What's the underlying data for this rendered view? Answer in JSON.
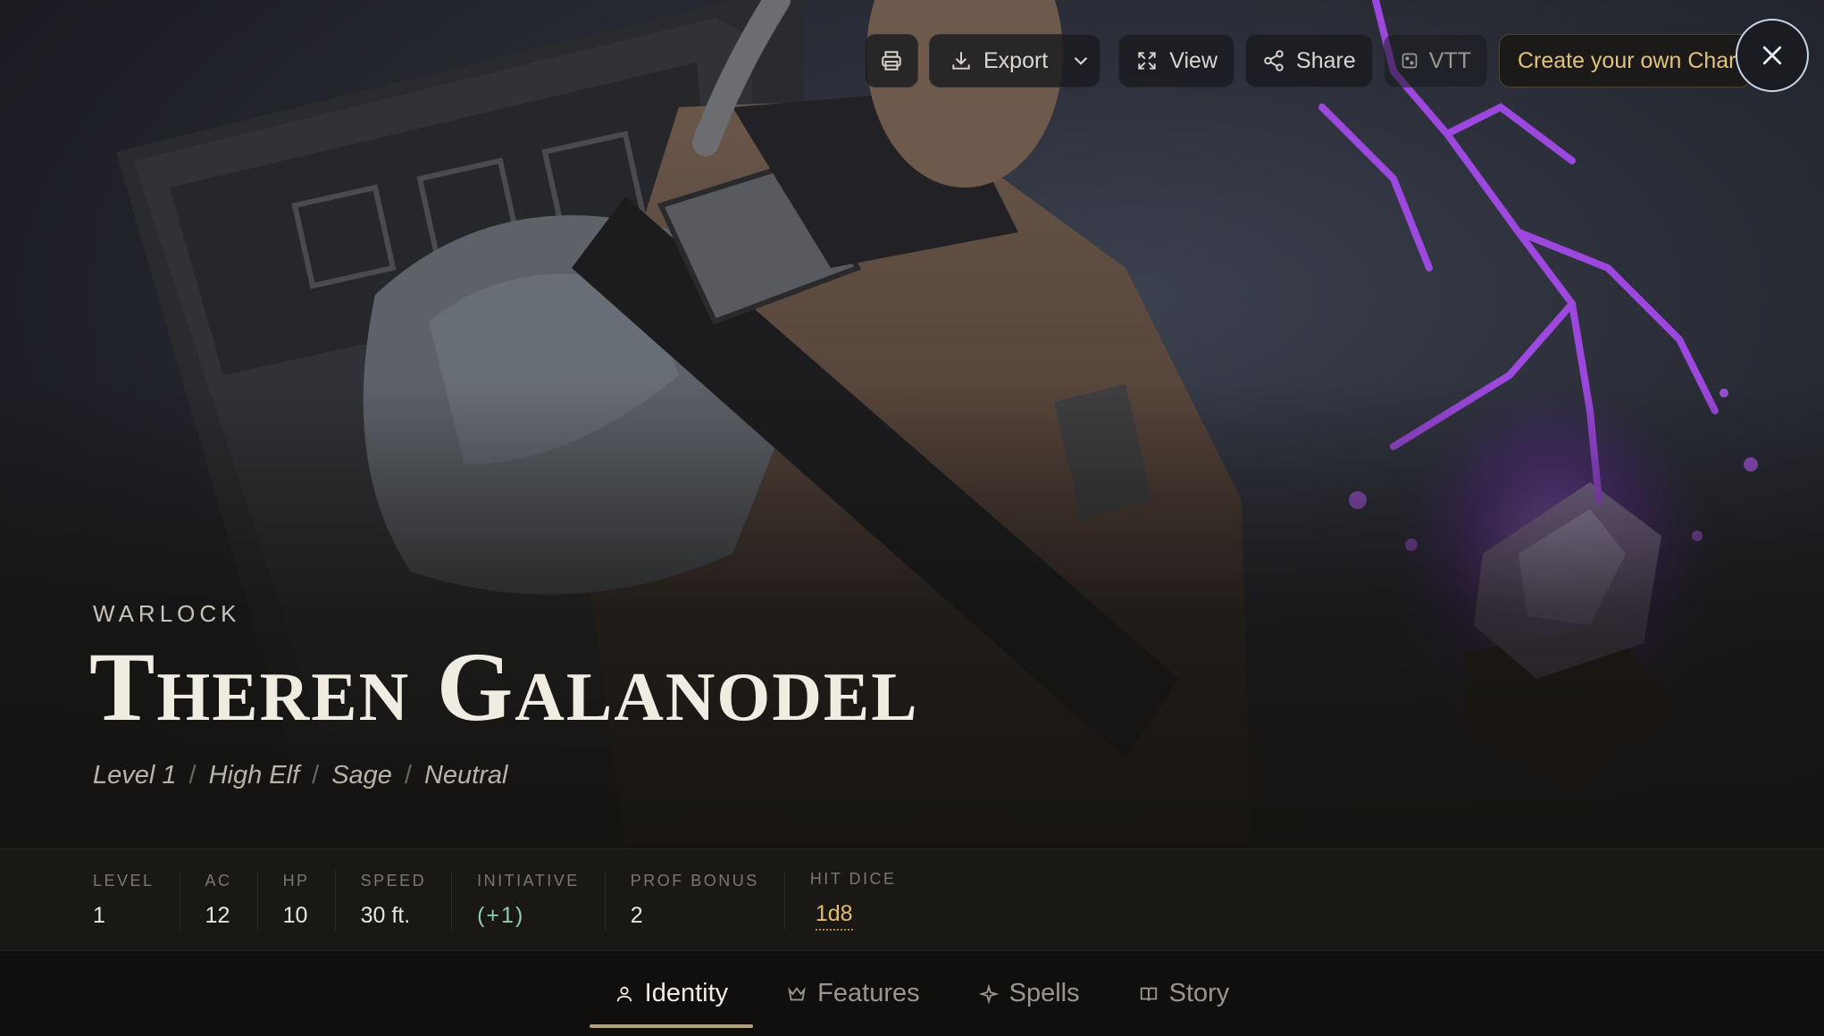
{
  "toolbar": {
    "print_icon": "printer-icon",
    "export_label": "Export",
    "view_label": "View",
    "share_label": "Share",
    "vtt_label": "VTT",
    "create_label": "Create your own Character",
    "close_icon": "close-icon"
  },
  "character": {
    "class": "WARLOCK",
    "name": "Theren Galanodel",
    "subline": [
      "Level 1",
      "High Elf",
      "Sage",
      "Neutral"
    ]
  },
  "stats": [
    {
      "label": "LEVEL",
      "value": "1"
    },
    {
      "label": "AC",
      "value": "12"
    },
    {
      "label": "HP",
      "value": "10"
    },
    {
      "label": "SPEED",
      "value": "30 ft."
    },
    {
      "label": "INITIATIVE",
      "value": "(+1)"
    },
    {
      "label": "PROF BONUS",
      "value": "2"
    },
    {
      "label": "HIT DICE",
      "value": "1d8"
    }
  ],
  "tabs": [
    {
      "label": "Identity",
      "icon": "person-icon",
      "active": true
    },
    {
      "label": "Features",
      "icon": "crown-icon",
      "active": false
    },
    {
      "label": "Spells",
      "icon": "sparkle-icon",
      "active": false
    },
    {
      "label": "Story",
      "icon": "book-icon",
      "active": false
    }
  ],
  "colors": {
    "accent_gold": "#e3bd68",
    "initiative_green": "#8fcfa5",
    "magic_purple": "#9b3ee8"
  }
}
